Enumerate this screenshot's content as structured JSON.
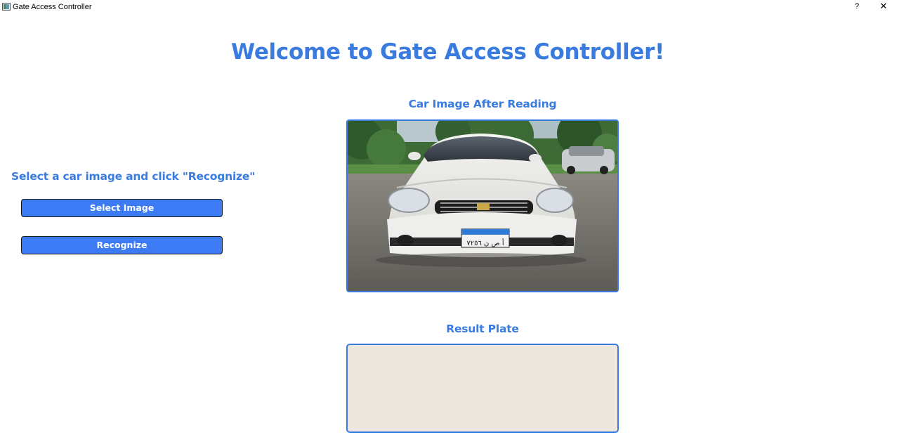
{
  "window": {
    "title": "Gate Access Controller",
    "help_label": "?",
    "close_label": "✕"
  },
  "main": {
    "title": "Welcome to Gate Access Controller!",
    "instruction": "Select a car image and click \"Recognize\"",
    "select_button_label": "Select Image",
    "recognize_button_label": "Recognize",
    "car_image_label": "Car Image After Reading",
    "result_label": "Result Plate",
    "result_text": ""
  },
  "car_image": {
    "plate_text": "أ ص ن ٧٢٥٦",
    "accent_color": "#3a7be0"
  },
  "colors": {
    "accent": "#3a7be0",
    "button": "#3c7bf4",
    "result_bg": "#ece8df"
  }
}
